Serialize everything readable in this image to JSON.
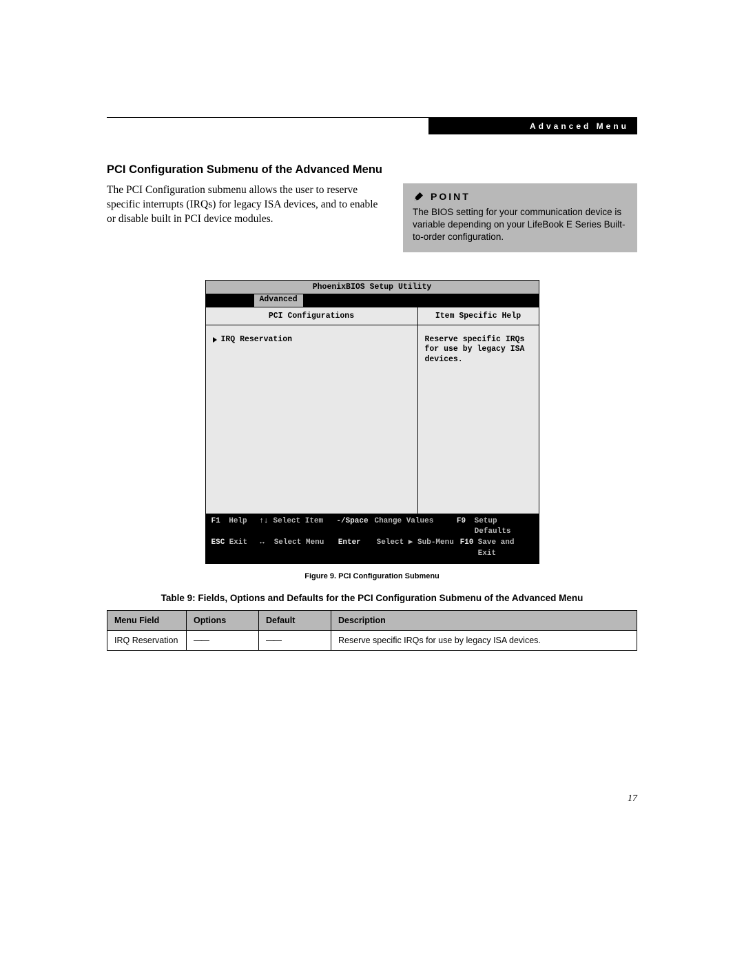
{
  "header": {
    "breadcrumb": "Advanced Menu"
  },
  "section": {
    "title": "PCI Configuration Submenu of the Advanced Menu",
    "intro": "The PCI Configuration submenu allows the user to reserve specific interrupts (IRQs) for legacy ISA devices, and to enable or disable built in PCI device modules."
  },
  "point": {
    "label": "POINT",
    "body": "The BIOS setting for your communication device is variable depending on your LifeBook E Series Built-to-order configuration."
  },
  "bios": {
    "title": "PhoenixBIOS Setup Utility",
    "active_tab": "Advanced",
    "left_header": "PCI Configurations",
    "right_header": "Item Specific Help",
    "items": [
      {
        "label": "IRQ Reservation"
      }
    ],
    "help_text": "Reserve specific IRQs for use by legacy ISA devices.",
    "footer": {
      "r1": {
        "k1": "F1",
        "l1": "Help",
        "k2": "↑↓",
        "l2": "Select Item",
        "k3": "-/Space",
        "l3": "Change Values",
        "k4": "F9",
        "l4": "Setup Defaults"
      },
      "r2": {
        "k1": "ESC",
        "l1": "Exit",
        "k2": "↔",
        "l2": "Select Menu",
        "k3": "Enter",
        "l3": "Select ▶ Sub-Menu",
        "k4": "F10",
        "l4": "Save and Exit"
      }
    }
  },
  "figure_caption": "Figure 9.  PCI Configuration Submenu",
  "table_caption": "Table 9: Fields, Options and Defaults for the PCI Configuration Submenu of the Advanced Menu",
  "table": {
    "headers": {
      "mf": "Menu Field",
      "op": "Options",
      "df": "Default",
      "de": "Description"
    },
    "rows": [
      {
        "mf": "IRQ Reservation",
        "op": "——",
        "df": "——",
        "de": "Reserve specific IRQs for use by legacy ISA devices."
      }
    ]
  },
  "page_number": "17"
}
